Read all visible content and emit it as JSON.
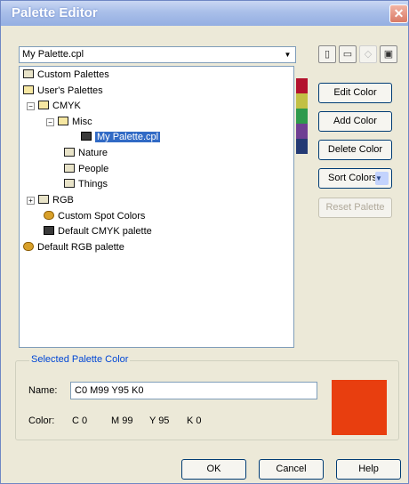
{
  "window": {
    "title": "Palette Editor",
    "close_glyph": "✕"
  },
  "palette_select": {
    "value": "My Palette.cpl",
    "arrow_glyph": "▼"
  },
  "toolbar": [
    {
      "icon": "new-palette-icon",
      "glyph": "▯",
      "enabled": true
    },
    {
      "icon": "open-palette-icon",
      "glyph": "▭",
      "enabled": true
    },
    {
      "icon": "save-palette-icon",
      "glyph": "◇",
      "enabled": false
    },
    {
      "icon": "save-as-palette-icon",
      "glyph": "▣",
      "enabled": true
    }
  ],
  "tree": {
    "items": [
      {
        "label": "Custom Palettes",
        "icon": "folder-icon"
      },
      {
        "label": "User's Palettes",
        "icon": "folder-open-icon"
      },
      {
        "label": "CMYK",
        "icon": "folder-open-icon",
        "expander": "−"
      },
      {
        "label": "Misc",
        "icon": "folder-open-icon",
        "expander": "−"
      },
      {
        "label": "My Palette.cpl",
        "icon": "palette-file-icon",
        "selected": true
      },
      {
        "label": "Nature",
        "icon": "folder-icon"
      },
      {
        "label": "People",
        "icon": "folder-icon"
      },
      {
        "label": "Things",
        "icon": "folder-icon"
      },
      {
        "label": "RGB",
        "icon": "folder-icon",
        "expander": "+"
      },
      {
        "label": "Custom Spot Colors",
        "icon": "spot-colors-icon"
      },
      {
        "label": "Default CMYK palette",
        "icon": "palette-file-icon"
      },
      {
        "label": "Default RGB palette",
        "icon": "spot-colors-icon"
      }
    ]
  },
  "swatch_colors": [
    "#b3122e",
    "#c2c045",
    "#2e9a4c",
    "#6f3f93",
    "#243a74"
  ],
  "buttons": {
    "edit_color": "Edit Color",
    "add_color": "Add Color",
    "delete_color": "Delete Color",
    "sort_colors": "Sort Colors",
    "sort_arrow": "▼",
    "reset_palette": "Reset Palette"
  },
  "selected_color": {
    "group_label": "Selected Palette Color",
    "name_label": "Name:",
    "name_value": "C0 M99 Y95 K0",
    "color_label": "Color:",
    "c": "C 0",
    "m": "M 99",
    "y": "Y 95",
    "k": "K 0",
    "preview_color": "#e83e0f"
  },
  "footer": {
    "ok": "OK",
    "cancel": "Cancel",
    "help": "Help"
  }
}
